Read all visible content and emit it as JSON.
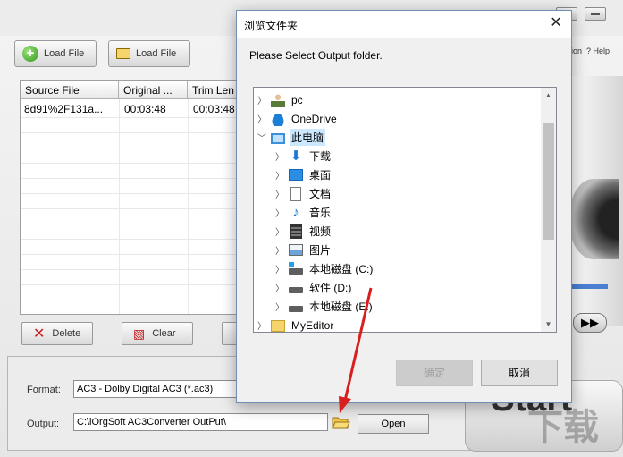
{
  "app": {
    "toolbar": {
      "load_file_1": "Load File",
      "load_file_2": "Load File",
      "registration_link": "ion",
      "help_link": "? Help"
    },
    "file_table": {
      "columns": [
        "Source File",
        "Original ...",
        "Trim Len"
      ],
      "rows": [
        {
          "source": "8d91%2F131a...",
          "original": "00:03:48",
          "trim": "00:03:48"
        }
      ]
    },
    "actions": {
      "delete_label": "Delete",
      "clear_label": "Clear"
    },
    "format": {
      "label": "Format:",
      "value": "AC3 - Dolby Digital AC3 (*.ac3)"
    },
    "output": {
      "label": "Output:",
      "value": "C:\\iOrgSoft AC3Converter OutPut\\",
      "open_label": "Open"
    },
    "start_label": "Start",
    "watermark": "下载"
  },
  "dialog": {
    "title": "浏览文件夹",
    "prompt": "Please Select Output folder.",
    "tree": [
      {
        "label": "pc",
        "icon": "user-icon",
        "level": 0,
        "expanded": false
      },
      {
        "label": "OneDrive",
        "icon": "cloud-icon",
        "level": 0,
        "expanded": false
      },
      {
        "label": "此电脑",
        "icon": "computer-icon",
        "level": 0,
        "expanded": true,
        "selected": true
      },
      {
        "label": "下载",
        "icon": "download-icon",
        "level": 1
      },
      {
        "label": "桌面",
        "icon": "desktop-icon",
        "level": 1
      },
      {
        "label": "文档",
        "icon": "document-icon",
        "level": 1
      },
      {
        "label": "音乐",
        "icon": "music-icon",
        "level": 1
      },
      {
        "label": "视频",
        "icon": "video-icon",
        "level": 1
      },
      {
        "label": "图片",
        "icon": "picture-icon",
        "level": 1
      },
      {
        "label": "本地磁盘 (C:)",
        "icon": "system-drive-icon",
        "level": 1
      },
      {
        "label": "软件 (D:)",
        "icon": "drive-icon",
        "level": 1
      },
      {
        "label": "本地磁盘 (E:)",
        "icon": "drive-icon",
        "level": 1
      },
      {
        "label": "MyEditor",
        "icon": "folder-icon",
        "level": 0
      }
    ],
    "ok_label": "确定",
    "cancel_label": "取消",
    "close_glyph": "✕"
  },
  "colors": {
    "selection": "#cce8ff",
    "annotation_arrow": "#d81e1e",
    "dialog_border": "#6f8fb6"
  }
}
